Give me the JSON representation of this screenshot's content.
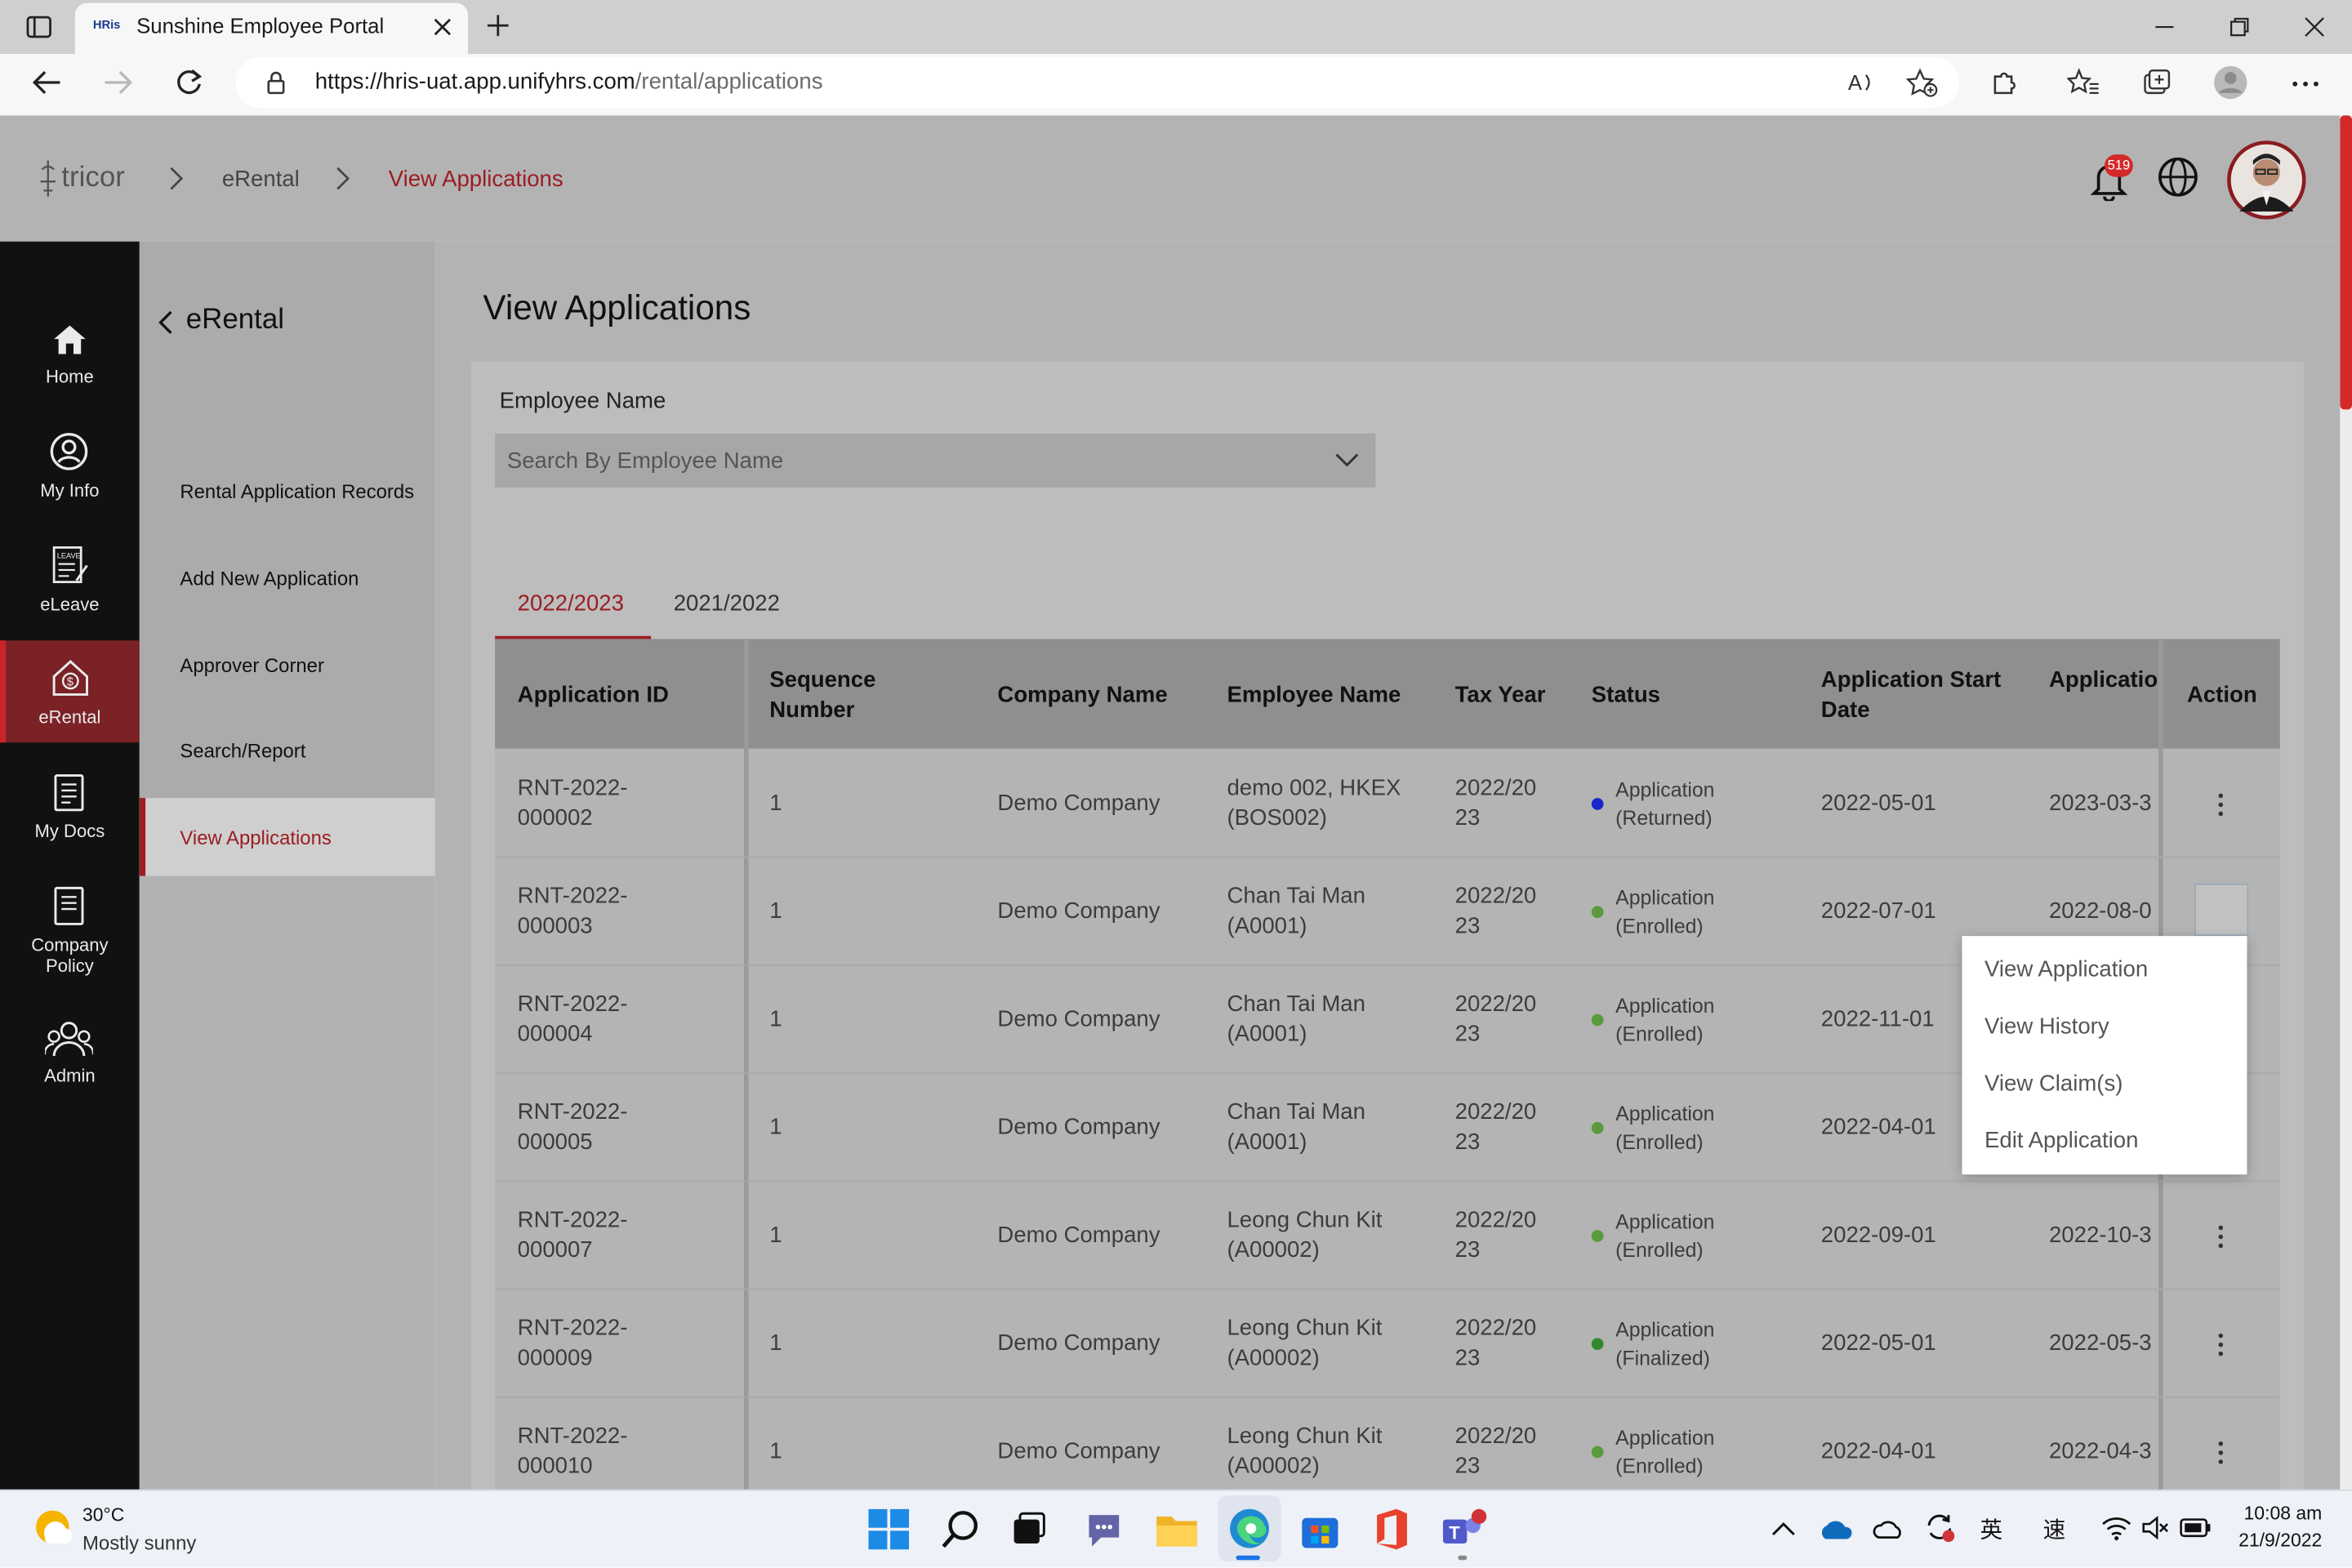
{
  "browser": {
    "tab_title": "Sunshine Employee Portal",
    "tab_favicon_text": "HRis",
    "url_host": "https://hris-uat.app.unifyhrs.com",
    "url_path": "/rental/applications",
    "icons": [
      "sidebar-toggle-icon",
      "close-icon",
      "new-tab-icon",
      "minimize-icon",
      "restore-icon",
      "window-close-icon",
      "back-icon",
      "forward-icon",
      "reload-icon",
      "lock-icon",
      "read-aloud-icon",
      "add-favorite-icon",
      "extensions-icon",
      "favorites-icon",
      "collections-icon",
      "profile-icon",
      "more-icon"
    ]
  },
  "header": {
    "logo_text": "tricor",
    "breadcrumb": [
      "eRental",
      "View Applications"
    ],
    "notification_count": "519",
    "icons": [
      "bell-icon",
      "globe-icon",
      "user-avatar"
    ]
  },
  "sidebar": {
    "items": [
      {
        "label": "Home",
        "icon": "home-icon"
      },
      {
        "label": "My Info",
        "icon": "user-circle-icon"
      },
      {
        "label": "eLeave",
        "icon": "leave-document-icon"
      },
      {
        "label": "eRental",
        "icon": "rental-house-icon"
      },
      {
        "label": "My Docs",
        "icon": "documents-icon"
      },
      {
        "label": "Company Policy",
        "icon": "policy-document-icon"
      },
      {
        "label": "Admin",
        "icon": "users-group-icon"
      }
    ],
    "active": "eRental"
  },
  "subnav": {
    "title": "eRental",
    "items": [
      "Rental Application Records",
      "Add New Application",
      "Approver Corner",
      "Search/Report",
      "View Applications"
    ],
    "active": "View Applications"
  },
  "main": {
    "title": "View Applications",
    "filter_label": "Employee Name",
    "filter_placeholder": "Search By Employee Name",
    "tabs": [
      "2022/2023",
      "2021/2022"
    ],
    "active_tab": "2022/2023",
    "columns": [
      "Application ID",
      "Sequence Number",
      "Company Name",
      "Employee Name",
      "Tax Year",
      "Status",
      "Application Start Date",
      "Application Date",
      "Action"
    ],
    "rows": [
      {
        "id_1": "RNT-2022-",
        "id_2": "000002",
        "seq": "1",
        "company": "Demo Company",
        "emp_1": "demo 002, HKEX",
        "emp_2": "(BOS002)",
        "year_1": "2022/20",
        "year_2": "23",
        "status_1": "Application",
        "status_2": "(Returned)",
        "status_color": "#1a27c9",
        "start": "2022-05-01",
        "date": "2023-03-3"
      },
      {
        "id_1": "RNT-2022-",
        "id_2": "000003",
        "seq": "1",
        "company": "Demo Company",
        "emp_1": "Chan Tai Man",
        "emp_2": "(A0001)",
        "year_1": "2022/20",
        "year_2": "23",
        "status_1": "Application",
        "status_2": "(Enrolled)",
        "status_color": "#5a9a3a",
        "start": "2022-07-01",
        "date": "2022-08-0"
      },
      {
        "id_1": "RNT-2022-",
        "id_2": "000004",
        "seq": "1",
        "company": "Demo Company",
        "emp_1": "Chan Tai Man",
        "emp_2": "(A0001)",
        "year_1": "2022/20",
        "year_2": "23",
        "status_1": "Application",
        "status_2": "(Enrolled)",
        "status_color": "#5a9a3a",
        "start": "2022-11-01",
        "date": ""
      },
      {
        "id_1": "RNT-2022-",
        "id_2": "000005",
        "seq": "1",
        "company": "Demo Company",
        "emp_1": "Chan Tai Man",
        "emp_2": "(A0001)",
        "year_1": "2022/20",
        "year_2": "23",
        "status_1": "Application",
        "status_2": "(Enrolled)",
        "status_color": "#5a9a3a",
        "start": "2022-04-01",
        "date": ""
      },
      {
        "id_1": "RNT-2022-",
        "id_2": "000007",
        "seq": "1",
        "company": "Demo Company",
        "emp_1": "Leong Chun Kit",
        "emp_2": "(A00002)",
        "year_1": "2022/20",
        "year_2": "23",
        "status_1": "Application",
        "status_2": "(Enrolled)",
        "status_color": "#5a9a3a",
        "start": "2022-09-01",
        "date": "2022-10-3"
      },
      {
        "id_1": "RNT-2022-",
        "id_2": "000009",
        "seq": "1",
        "company": "Demo Company",
        "emp_1": "Leong Chun Kit",
        "emp_2": "(A00002)",
        "year_1": "2022/20",
        "year_2": "23",
        "status_1": "Application",
        "status_2": "(Finalized)",
        "status_color": "#2f8a2f",
        "start": "2022-05-01",
        "date": "2022-05-3"
      },
      {
        "id_1": "RNT-2022-",
        "id_2": "000010",
        "seq": "1",
        "company": "Demo Company",
        "emp_1": "Leong Chun Kit",
        "emp_2": "(A00002)",
        "year_1": "2022/20",
        "year_2": "23",
        "status_1": "Application",
        "status_2": "(Enrolled)",
        "status_color": "#5a9a3a",
        "start": "2022-04-01",
        "date": "2022-04-3"
      }
    ],
    "action_menu": [
      "View Application",
      "View History",
      "View Claim(s)",
      "Edit Application"
    ]
  },
  "taskbar": {
    "weather_temp": "30°C",
    "weather_desc": "Mostly sunny",
    "ime_label_1": "英",
    "ime_label_2": "速",
    "time": "10:08 am",
    "date": "21/9/2022",
    "icons": [
      "windows-start-icon",
      "search-icon",
      "task-view-icon",
      "chat-icon",
      "file-explorer-icon",
      "edge-icon",
      "store-icon",
      "office-icon",
      "teams-icon",
      "chevron-up-icon",
      "onedrive-icon",
      "cloud-icon",
      "sync-icon",
      "wifi-icon",
      "volume-muted-icon",
      "battery-icon"
    ]
  }
}
